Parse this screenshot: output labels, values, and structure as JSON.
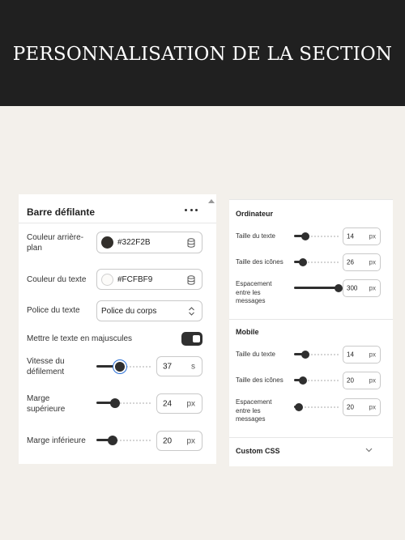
{
  "header": {
    "title": "PERSONNALISATION DE LA SECTION"
  },
  "left_panel": {
    "title": "Barre défilante",
    "bg_color": {
      "label": "Couleur arrière-plan",
      "value": "#322F2B",
      "swatch": "#322F2B"
    },
    "text_color": {
      "label": "Couleur du texte",
      "value": "#FCFBF9",
      "swatch": "#FCFBF9"
    },
    "font": {
      "label": "Police du texte",
      "value": "Police du corps"
    },
    "uppercase": {
      "label": "Mettre le texte en majuscules",
      "checked": true
    },
    "speed": {
      "label": "Vitesse du défilement",
      "value": "37",
      "unit": "s",
      "level": 0.43
    },
    "margin_top": {
      "label": "Marge supérieure",
      "value": "24",
      "unit": "px",
      "level": 0.35
    },
    "margin_bottom": {
      "label": "Marge inférieure",
      "value": "20",
      "unit": "px",
      "level": 0.3
    }
  },
  "right_panel": {
    "desktop": {
      "heading": "Ordinateur",
      "text_size": {
        "label": "Taille du texte",
        "value": "14",
        "unit": "px",
        "level": 0.25
      },
      "icon_size": {
        "label": "Taille des icônes",
        "value": "26",
        "unit": "px",
        "level": 0.2
      },
      "spacing": {
        "label": "Espacement entre les messages",
        "value": "300",
        "unit": "px",
        "level": 1.0
      }
    },
    "mobile": {
      "heading": "Mobile",
      "text_size": {
        "label": "Taille du texte",
        "value": "14",
        "unit": "px",
        "level": 0.25
      },
      "icon_size": {
        "label": "Taille des icônes",
        "value": "20",
        "unit": "px",
        "level": 0.2
      },
      "spacing": {
        "label": "Espacement entre les messages",
        "value": "20",
        "unit": "px",
        "level": 0.1
      }
    },
    "custom_css": {
      "label": "Custom CSS"
    }
  },
  "icons": {
    "more": "more-horizontal-icon",
    "database": "database-icon",
    "select": "select-arrows-icon",
    "chevron": "chevron-down-icon"
  }
}
